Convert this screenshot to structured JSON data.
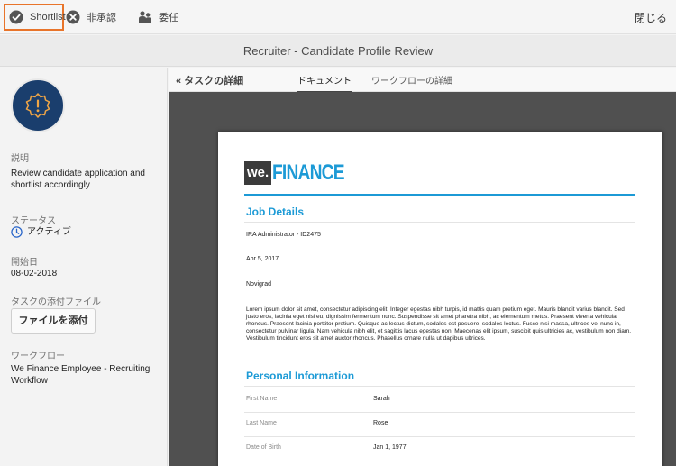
{
  "toolbar": {
    "shortlist_label": "Shortlist",
    "reject_label": "非承認",
    "delegate_label": "委任",
    "close_label": "閉じる"
  },
  "header": {
    "title": "Recruiter - Candidate Profile Review"
  },
  "sidebar": {
    "description_label": "説明",
    "description_value": "Review candidate application and shortlist accordingly",
    "status_label": "ステータス",
    "status_value": "アクティブ",
    "start_date_label": "開始日",
    "start_date_value": "08-02-2018",
    "attachments_label": "タスクの添付ファイル",
    "attach_button": "ファイルを添付",
    "workflow_label": "ワークフロー",
    "workflow_value": "We Finance Employee - Recruiting Workflow"
  },
  "tabs": {
    "back_label": "タスクの詳細",
    "document": "ドキュメント",
    "workflow_details": "ワークフローの詳細"
  },
  "document": {
    "logo_we": "we.",
    "logo_finance": "FINANCE",
    "job_details_title": "Job Details",
    "job_lines": [
      "IRA Administrator - ID2475",
      "Apr 5, 2017",
      "Novigrad"
    ],
    "description": "Lorem ipsum dolor sit amet, consectetur adipiscing elit. Integer egestas nibh turpis, id mattis quam pretium eget. Mauris blandit varius blandit. Sed justo eros, lacinia eget nisi eu, dignissim fermentum nunc. Suspendisse sit amet pharetra nibh, ac elementum metus. Praesent viverra vehicula rhoncus. Praesent lacinia porttitor pretium. Quisque ac lectus dictum, sodales est posuere, sodales lectus. Fusce nisi massa, ultrices vel nunc in, consectetur pulvinar ligula. Nam vehicula nibh elit, et sagittis lacus egestas non. Maecenas elit ipsum, suscipit quis ultricies ac, vestibulum non diam. Vestibulum tincidunt eros sit amet auctor rhoncus. Phasellus ornare nulla ut dapibus ultrices.",
    "personal_title": "Personal Information",
    "fields": [
      {
        "label": "First Name",
        "value": "Sarah"
      },
      {
        "label": "Last Name",
        "value": "Rose"
      },
      {
        "label": "Date of Birth",
        "value": "Jan 1, 1977"
      }
    ]
  },
  "colors": {
    "accent": "#1c9ad6",
    "highlight": "#e8742a",
    "avatar_bg": "#1a3e6d",
    "status_icon": "#2a66c9",
    "viewer_bg": "#505050"
  },
  "icons": {
    "shortlist": "check-circle-icon",
    "reject": "x-circle-icon",
    "delegate": "people-icon",
    "avatar": "alert-gear-icon",
    "status": "clock-icon",
    "back": "double-chevron-left-icon"
  }
}
